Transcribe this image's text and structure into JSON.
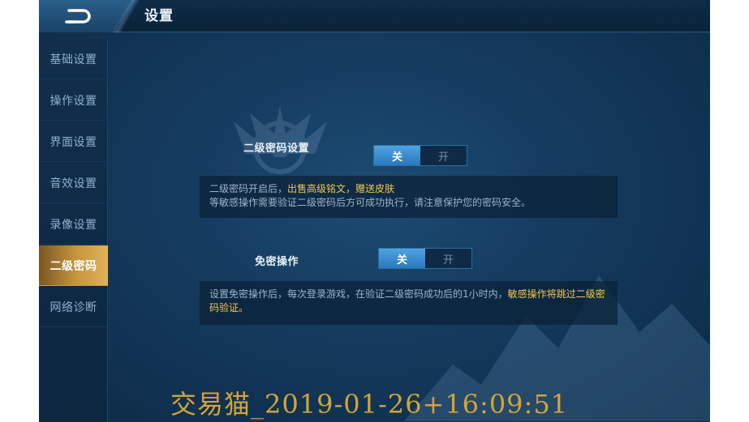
{
  "header": {
    "title": "设置",
    "back_icon": "back-arrow-icon"
  },
  "sidebar": {
    "items": [
      {
        "label": "基础设置",
        "active": false
      },
      {
        "label": "操作设置",
        "active": false
      },
      {
        "label": "界面设置",
        "active": false
      },
      {
        "label": "音效设置",
        "active": false
      },
      {
        "label": "录像设置",
        "active": false
      },
      {
        "label": "二级密码",
        "active": true
      },
      {
        "label": "网络诊断",
        "active": false
      }
    ]
  },
  "main": {
    "secondary_password": {
      "label": "二级密码设置",
      "toggle": {
        "off": "关",
        "on": "开",
        "selected": "关"
      },
      "note_line1_prefix": "二级密码开启后，",
      "note_line1_highlight1": "出售高级铭文",
      "note_line1_sep": "，",
      "note_line1_highlight2": "赠送皮肤",
      "note_line2": "等敏感操作需要验证二级密码后方可成功执行，请注意保护您的密码安全。"
    },
    "password_free": {
      "label": "免密操作",
      "toggle": {
        "off": "关",
        "on": "开",
        "selected": "关"
      },
      "note_prefix": "设置免密操作后，每次登录游戏，在验证二级密码成功后的1小时内，",
      "note_highlight": "敏感操作将跳过二级密码验证。"
    }
  },
  "colors": {
    "accent_blue": "#2a78c0",
    "highlight_yellow": "#f2c94c",
    "active_gold": "#c7963f"
  },
  "watermark": "交易猫_2019-01-26+16:09:51"
}
